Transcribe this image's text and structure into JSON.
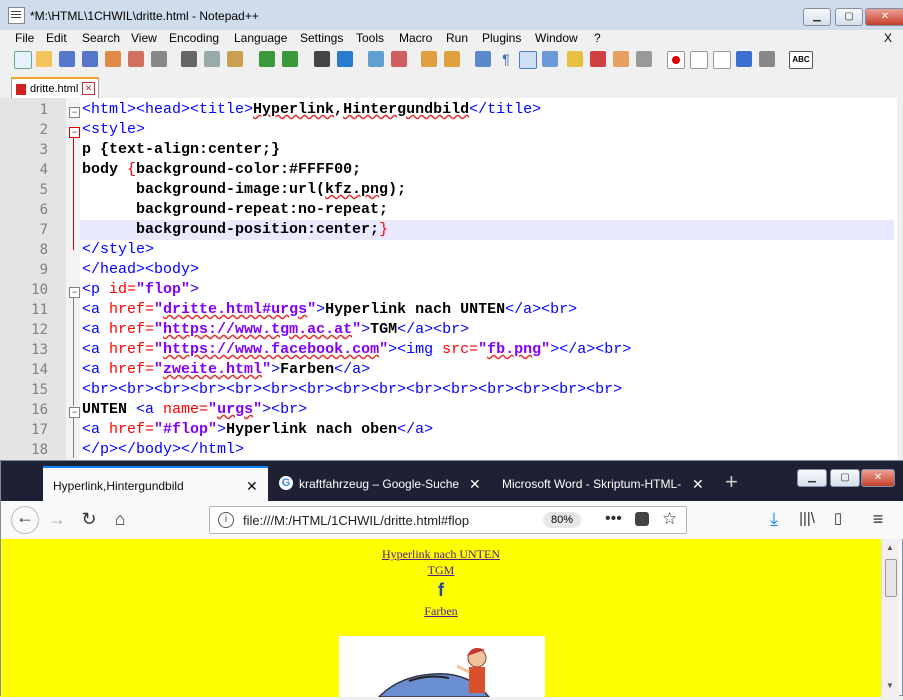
{
  "notepad": {
    "title": "*M:\\HTML\\1CHWIL\\dritte.html - Notepad++",
    "menu": [
      "File",
      "Edit",
      "Search",
      "View",
      "Encoding",
      "Language",
      "Settings",
      "Tools",
      "Macro",
      "Run",
      "Plugins",
      "Window",
      "?"
    ],
    "menu_close": "X",
    "tab_label": "dritte.html",
    "line_numbers": [
      "1",
      "2",
      "3",
      "4",
      "5",
      "6",
      "7",
      "8",
      "9",
      "10",
      "11",
      "12",
      "13",
      "14",
      "15",
      "16",
      "17",
      "18"
    ],
    "toolbar_text_icon": "ABC"
  },
  "firefox": {
    "tabs": [
      {
        "label": "Hyperlink,Hintergundbild",
        "active": true
      },
      {
        "label": "kraftfahrzeug – Google-Suche",
        "active": false
      },
      {
        "label": "Microsoft Word - Skriptum-HTML-",
        "active": false
      }
    ],
    "new_tab": "+",
    "url": "file:///M:/HTML/1CHWIL/dritte.html#flop",
    "zoom": "80%",
    "page": {
      "link_unten": "Hyperlink nach UNTEN",
      "link_tgm": "TGM",
      "facebook_glyph": "f",
      "link_farben": "Farben"
    }
  },
  "colors": {
    "page_background": "#FFFF00",
    "tag": "#0000FF",
    "attribute": "#FF0000",
    "value": "#8000FF"
  }
}
